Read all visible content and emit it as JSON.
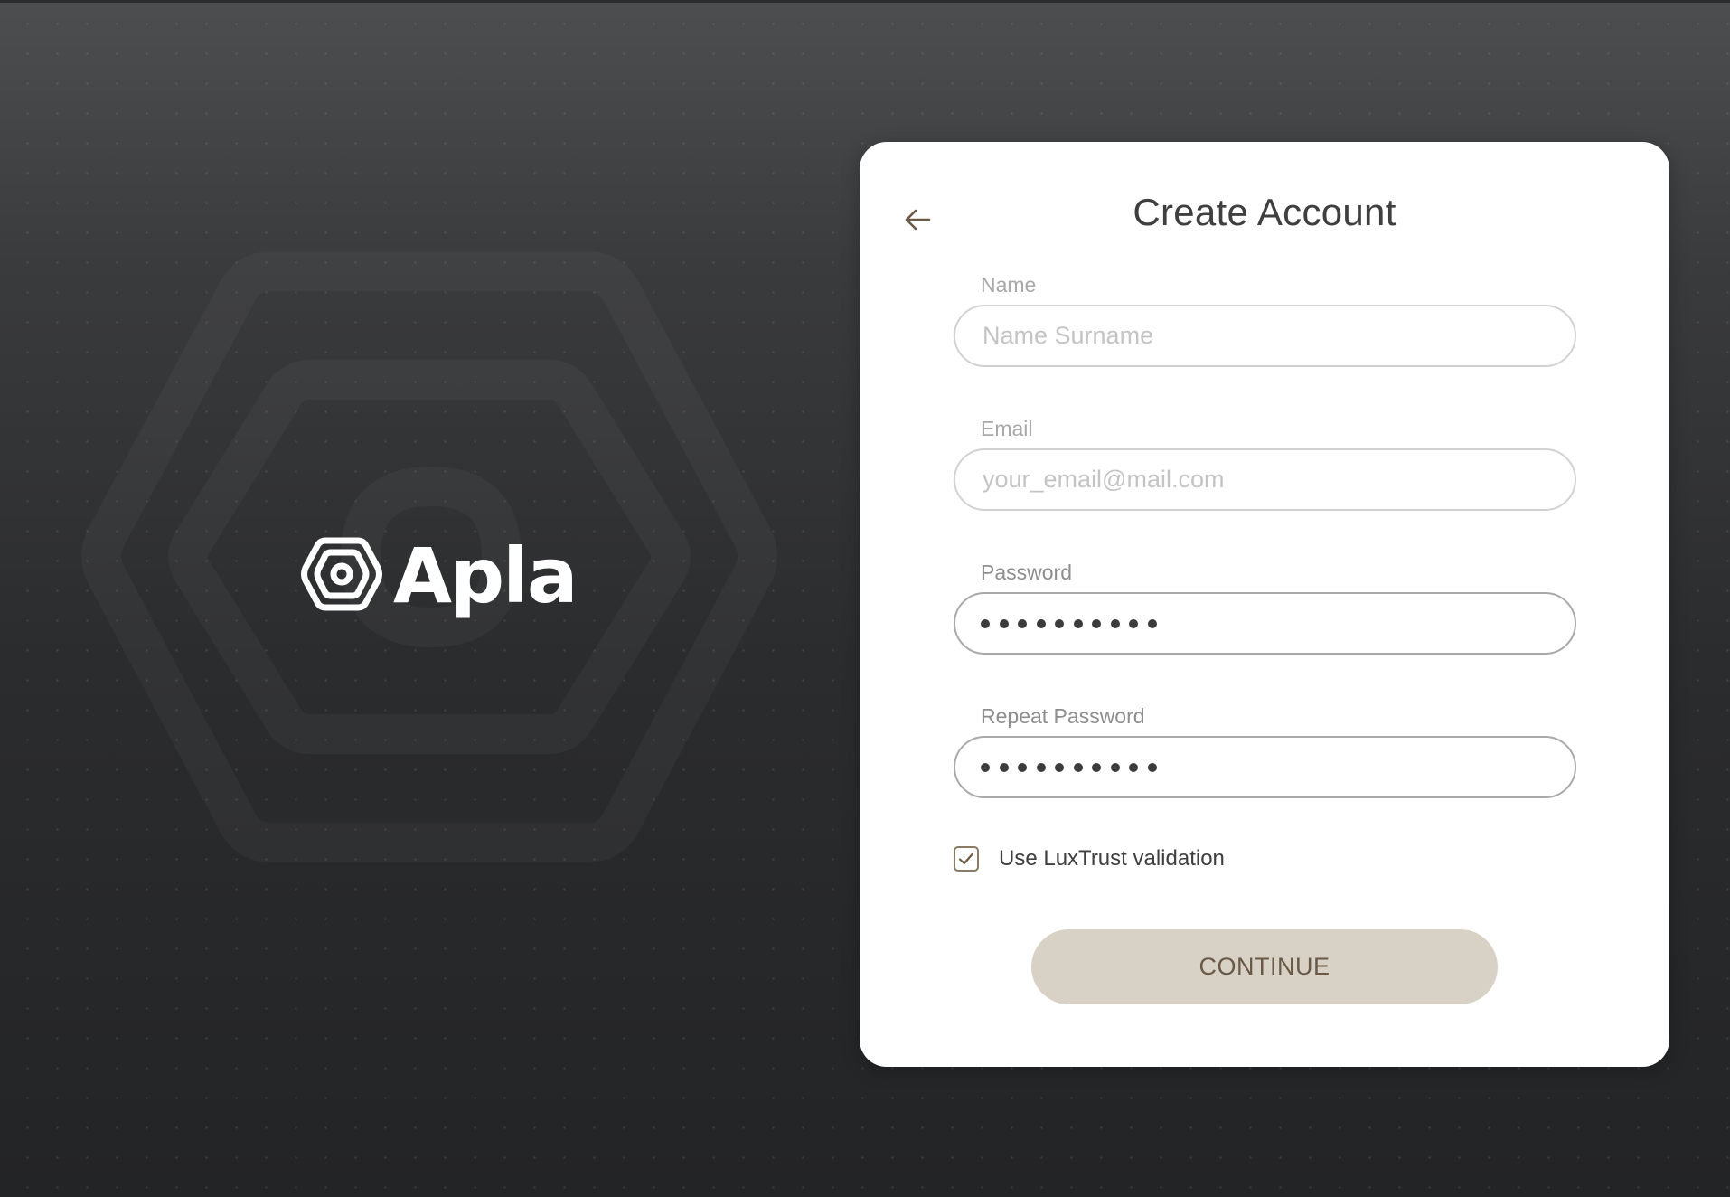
{
  "brand": {
    "name": "Apla",
    "logo_icon": "apla-hexagon-logo"
  },
  "card": {
    "title": "Create Account",
    "back_icon": "arrow-left-icon"
  },
  "form": {
    "name": {
      "label": "Name",
      "placeholder": "Name Surname",
      "value": ""
    },
    "email": {
      "label": "Email",
      "placeholder": "your_email@mail.com",
      "value": ""
    },
    "password": {
      "label": "Password",
      "masked_length": 10
    },
    "repeat_password": {
      "label": "Repeat Password",
      "masked_length": 10
    },
    "luxtrust": {
      "label": "Use LuxTrust validation",
      "checked": true
    },
    "continue_label": "CONTINUE"
  },
  "colors": {
    "accent": "#8a7a66",
    "button_bg": "#d8d1c5",
    "button_text": "#6a5a45",
    "card_bg": "#ffffff",
    "background_top": "#4d4e50",
    "background_bottom": "#232426"
  }
}
